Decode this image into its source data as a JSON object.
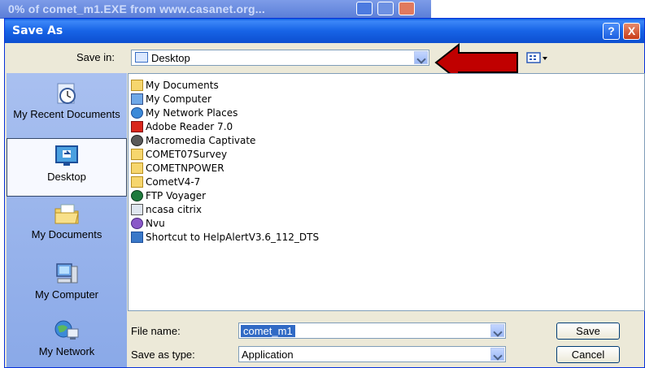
{
  "background_window": {
    "title": "0% of comet_m1.EXE from www.casanet.org..."
  },
  "dialog": {
    "title": "Save As",
    "help_label": "?",
    "close_label": "X"
  },
  "save_in": {
    "label": "Save in:",
    "value": "Desktop"
  },
  "places": [
    {
      "label": "My Recent Documents",
      "icon": "clock-document-icon"
    },
    {
      "label": "Desktop",
      "icon": "desktop-icon"
    },
    {
      "label": "My Documents",
      "icon": "folder-documents-icon"
    },
    {
      "label": "My Computer",
      "icon": "computer-icon"
    },
    {
      "label": "My Network",
      "icon": "network-globe-icon"
    }
  ],
  "files": [
    {
      "name": "My Documents",
      "icon": "folder-icon"
    },
    {
      "name": "My Computer",
      "icon": "computer-icon"
    },
    {
      "name": "My Network Places",
      "icon": "network-icon"
    },
    {
      "name": "Adobe Reader 7.0",
      "icon": "adobe-shortcut-icon"
    },
    {
      "name": "Macromedia Captivate",
      "icon": "captivate-shortcut-icon"
    },
    {
      "name": "COMET07Survey",
      "icon": "folder-icon"
    },
    {
      "name": "COMETNPOWER",
      "icon": "folder-icon"
    },
    {
      "name": "CometV4-7",
      "icon": "folder-icon"
    },
    {
      "name": "FTP Voyager",
      "icon": "ftp-shortcut-icon"
    },
    {
      "name": "ncasa citrix",
      "icon": "citrix-shortcut-icon"
    },
    {
      "name": "Nvu",
      "icon": "nvu-shortcut-icon"
    },
    {
      "name": "Shortcut to HelpAlertV3.6_112_DTS",
      "icon": "helpalert-shortcut-icon"
    }
  ],
  "file_name": {
    "label": "File name:",
    "value": "comet_m1"
  },
  "save_as_type": {
    "label": "Save as type:",
    "value": "Application"
  },
  "buttons": {
    "save": "Save",
    "cancel": "Cancel"
  },
  "colors": {
    "titlebar": "#0a5fe0",
    "dialog_bg": "#ece9d8",
    "selection": "#316ac5",
    "annotation_arrow": "#c00000"
  }
}
